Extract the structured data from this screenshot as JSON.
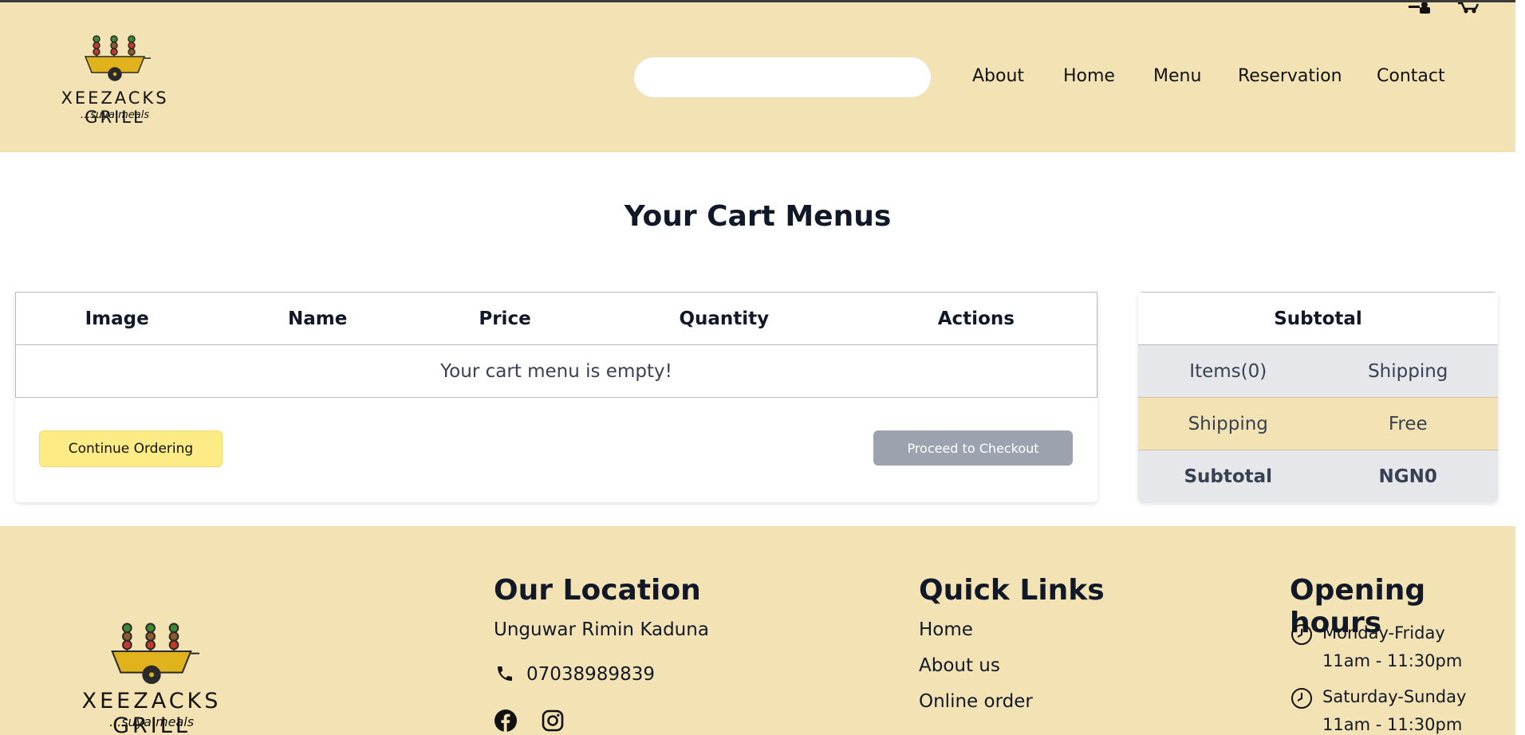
{
  "brand": {
    "name": "XEEZACKS GRILL",
    "tagline": "...suya meals"
  },
  "search": {
    "placeholder": ""
  },
  "nav": [
    {
      "label": "About"
    },
    {
      "label": "Home"
    },
    {
      "label": "Menu"
    },
    {
      "label": "Reservation"
    },
    {
      "label": "Contact"
    }
  ],
  "top_icons": [
    "user-icon",
    "cart-icon"
  ],
  "page": {
    "title": "Your Cart Menus"
  },
  "cart": {
    "columns": [
      "Image",
      "Name",
      "Price",
      "Quantity",
      "Actions"
    ],
    "empty_message": "Your cart menu is empty!",
    "continue_label": "Continue Ordering",
    "checkout_label": "Proceed to Checkout"
  },
  "summary": {
    "header": "Subtotal",
    "rows": [
      {
        "left": "Items(0)",
        "right": "Shipping"
      },
      {
        "left": "Shipping",
        "right": "Free"
      },
      {
        "left": "Subtotal",
        "right": "NGN0"
      }
    ]
  },
  "footer": {
    "location": {
      "heading": "Our Location",
      "address": "Unguwar Rimin Kaduna",
      "phone": "07038989839",
      "social": [
        "facebook-icon",
        "instagram-icon"
      ]
    },
    "quick_links": {
      "heading": "Quick Links",
      "items": [
        "Home",
        "About us",
        "Online order"
      ]
    },
    "hours": {
      "heading": "Opening hours",
      "items": [
        {
          "days": "Monday-Friday",
          "time": "11am - 11:30pm"
        },
        {
          "days": "Saturday-Sunday",
          "time": "11am - 11:30pm"
        }
      ]
    }
  },
  "colors": {
    "cream": "#f3e2b3",
    "yellow_button": "#fdec85",
    "disabled_button": "#9ca3af",
    "row_gray": "#e5e7eb"
  }
}
